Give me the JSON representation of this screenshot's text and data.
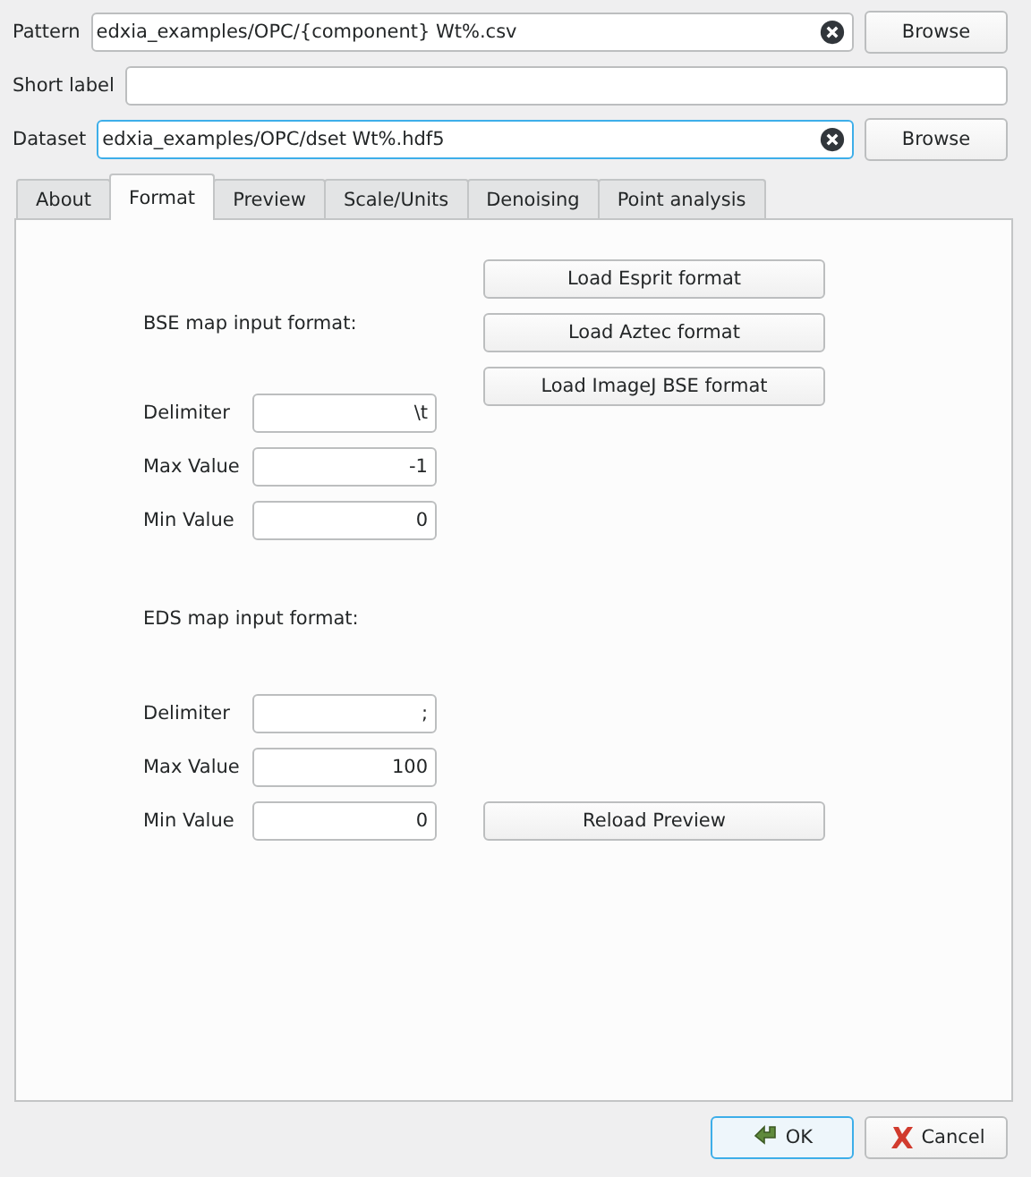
{
  "fields": [
    {
      "label": "Pattern",
      "value": "edxia_examples/OPC/{component} Wt%.csv",
      "focused": false,
      "button": "Browse"
    },
    {
      "label": "Short label",
      "focused": false
    },
    {
      "label": "Dataset",
      "value": "edxia_examples/OPC/dset Wt%.hdf5",
      "focused": true,
      "button": "Browse"
    }
  ],
  "tabs": [
    {
      "label": "About",
      "selected": false
    },
    {
      "label": "Format",
      "selected": true
    },
    {
      "label": "Preview",
      "selected": false
    },
    {
      "label": "Scale/Units",
      "selected": false
    },
    {
      "label": "Denoising",
      "selected": false
    },
    {
      "label": "Point analysis",
      "selected": false
    }
  ],
  "bse": {
    "heading": "BSE map input format:",
    "buttons": [
      "Load Esprit format",
      "Load Aztec format",
      "Load ImageJ BSE format"
    ],
    "rows": [
      {
        "label": "Delimiter",
        "value": "\\t"
      },
      {
        "label": "Max Value",
        "value": "-1"
      },
      {
        "label": "Min Value",
        "value": "0"
      }
    ]
  },
  "eds": {
    "heading": "EDS map input format:",
    "button": "Reload Preview",
    "rows": [
      {
        "label": "Delimiter",
        "value": ";"
      },
      {
        "label": "Max Value",
        "value": "100"
      },
      {
        "label": "Min Value",
        "value": "0"
      }
    ]
  },
  "dialog_buttons": [
    {
      "label": "OK",
      "kind": "ok",
      "default": true
    },
    {
      "label": "Cancel",
      "kind": "cancel",
      "default": false
    }
  ]
}
